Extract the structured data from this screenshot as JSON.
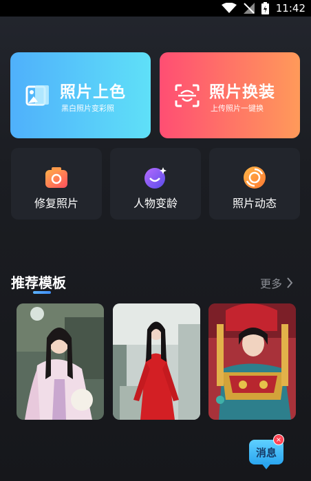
{
  "status": {
    "time": "11:42"
  },
  "feature_cards": [
    {
      "title": "照片上色",
      "subtitle": "黑白照片变彩照",
      "icon": "photo-color-icon"
    },
    {
      "title": "照片换装",
      "subtitle": "上传照片一键换",
      "icon": "face-scan-icon"
    }
  ],
  "tools": [
    {
      "label": "修复照片",
      "icon": "camera-icon"
    },
    {
      "label": "人物变龄",
      "icon": "moon-face-icon"
    },
    {
      "label": "照片动态",
      "icon": "shutter-icon"
    }
  ],
  "section": {
    "title": "推荐模板",
    "more": "更多"
  },
  "templates": [
    {
      "icon": "template-hanfu-pink"
    },
    {
      "icon": "template-red-dress"
    },
    {
      "icon": "template-tibetan-costume"
    }
  ],
  "message": {
    "label": "消息",
    "badge": "×"
  },
  "colors": {
    "accent": "#3e8cf2",
    "card_blue": "#4fb0fb",
    "card_red": "#ff4e73",
    "tile_bg": "#22252c"
  }
}
